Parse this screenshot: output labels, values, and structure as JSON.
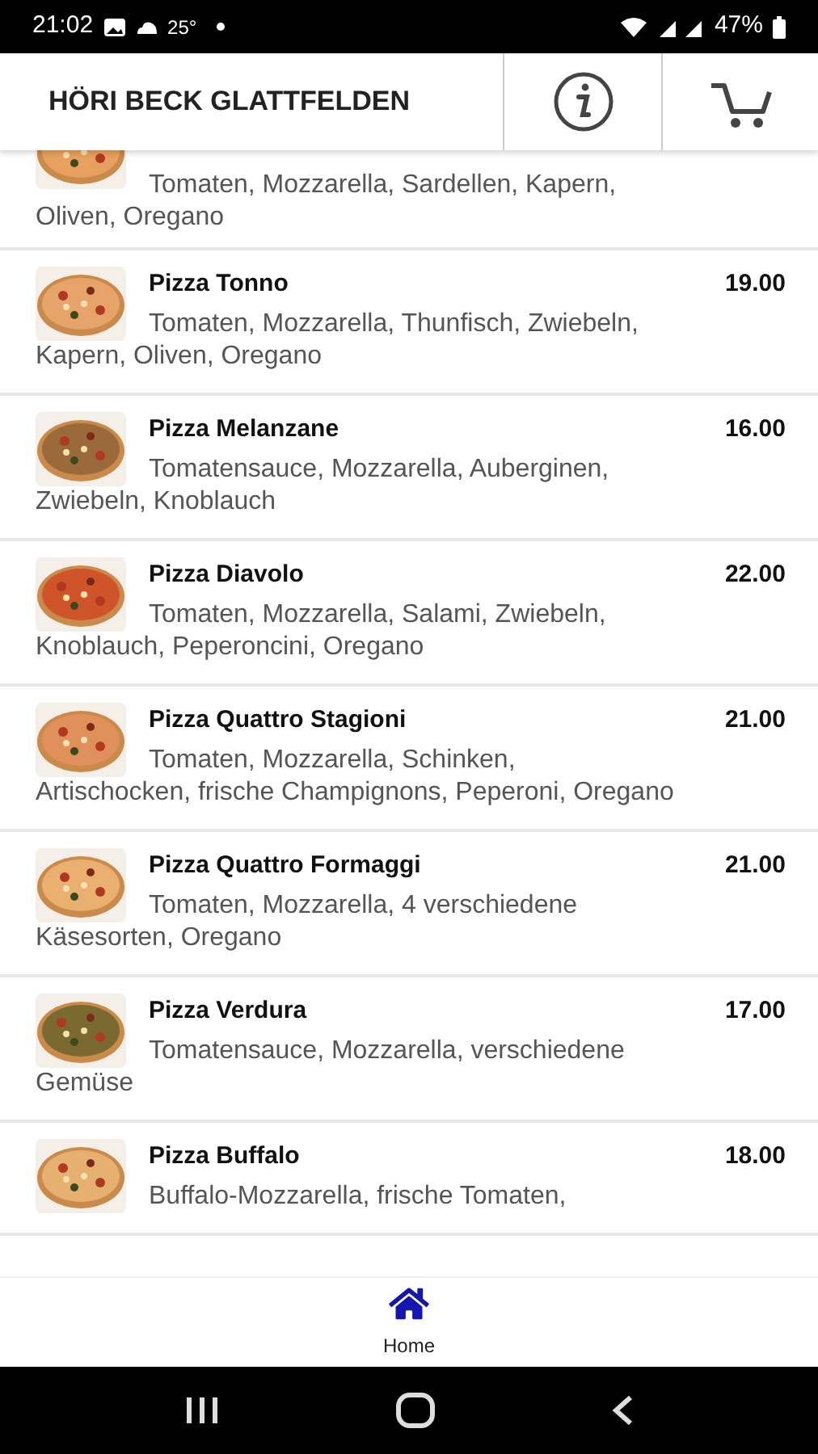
{
  "status_bar": {
    "time": "21:02",
    "temperature": "25°",
    "battery": "47%"
  },
  "header": {
    "title": "HÖRI BECK GLATTFELDEN"
  },
  "menu": {
    "items": [
      {
        "description": "Tomaten, Mozzarella, Sardellen, Kapern, Oliven, Oregano"
      },
      {
        "name": "Pizza Tonno",
        "price": "19.00",
        "description": "Tomaten, Mozzarella, Thunfisch, Zwiebeln, Kapern, Oliven, Oregano"
      },
      {
        "name": "Pizza Melanzane",
        "price": "16.00",
        "description": "Tomatensauce, Mozzarella, Auberginen, Zwiebeln, Knoblauch"
      },
      {
        "name": "Pizza Diavolo",
        "price": "22.00",
        "description": "Tomaten, Mozzarella, Salami, Zwiebeln, Knoblauch, Peperoncini, Oregano"
      },
      {
        "name": "Pizza Quattro Stagioni",
        "price": "21.00",
        "description": "Tomaten, Mozzarella, Schinken, Artischocken, frische Champignons, Peperoni, Oregano"
      },
      {
        "name": "Pizza Quattro Formaggi",
        "price": "21.00",
        "description": "Tomaten, Mozzarella, 4 verschiedene Käsesorten, Oregano"
      },
      {
        "name": "Pizza Verdura",
        "price": "17.00",
        "description": "Tomatensauce, Mozzarella, verschiedene Gemüse"
      },
      {
        "name": "Pizza Buffalo",
        "price": "18.00",
        "description": "Buffalo-Mozzarella, frische Tomaten,"
      }
    ]
  },
  "bottom_nav": [
    {
      "label": "Home",
      "selected": true
    }
  ]
}
